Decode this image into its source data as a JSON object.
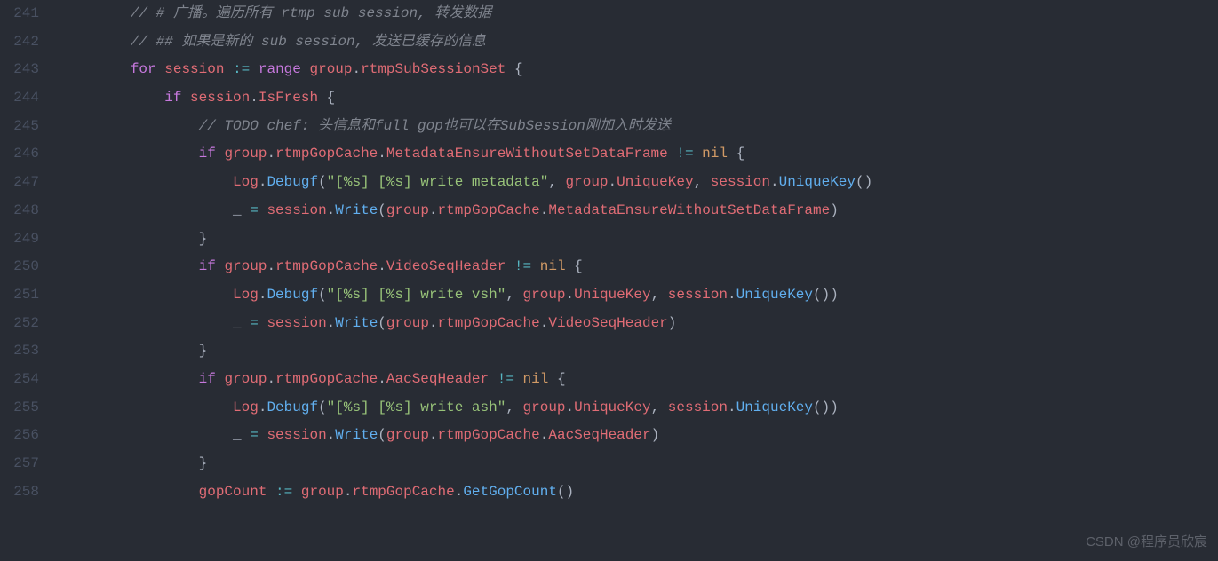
{
  "watermark": "CSDN @程序员欣宸",
  "lines": [
    {
      "n": "241",
      "indent": 2,
      "segs": [
        {
          "c": "cm",
          "t": "// # 广播。遍历所有 rtmp sub session, 转发数据"
        }
      ]
    },
    {
      "n": "242",
      "indent": 2,
      "segs": [
        {
          "c": "cm",
          "t": "// ## 如果是新的 sub session, 发送已缓存的信息"
        }
      ]
    },
    {
      "n": "243",
      "indent": 2,
      "segs": [
        {
          "c": "kw",
          "t": "for"
        },
        {
          "c": "pl",
          "t": " "
        },
        {
          "c": "id",
          "t": "session"
        },
        {
          "c": "pl",
          "t": " "
        },
        {
          "c": "op",
          "t": ":="
        },
        {
          "c": "pl",
          "t": " "
        },
        {
          "c": "kw",
          "t": "range"
        },
        {
          "c": "pl",
          "t": " "
        },
        {
          "c": "id",
          "t": "group"
        },
        {
          "c": "pl",
          "t": "."
        },
        {
          "c": "id",
          "t": "rtmpSubSessionSet"
        },
        {
          "c": "pl",
          "t": " {"
        }
      ]
    },
    {
      "n": "244",
      "indent": 3,
      "segs": [
        {
          "c": "kw",
          "t": "if"
        },
        {
          "c": "pl",
          "t": " "
        },
        {
          "c": "id",
          "t": "session"
        },
        {
          "c": "pl",
          "t": "."
        },
        {
          "c": "id",
          "t": "IsFresh"
        },
        {
          "c": "pl",
          "t": " {"
        }
      ]
    },
    {
      "n": "245",
      "indent": 4,
      "segs": [
        {
          "c": "cm",
          "t": "// TODO chef: 头信息和full gop也可以在SubSession刚加入时发送"
        }
      ]
    },
    {
      "n": "246",
      "indent": 4,
      "segs": [
        {
          "c": "kw",
          "t": "if"
        },
        {
          "c": "pl",
          "t": " "
        },
        {
          "c": "id",
          "t": "group"
        },
        {
          "c": "pl",
          "t": "."
        },
        {
          "c": "id",
          "t": "rtmpGopCache"
        },
        {
          "c": "pl",
          "t": "."
        },
        {
          "c": "id",
          "t": "MetadataEnsureWithoutSetDataFrame"
        },
        {
          "c": "pl",
          "t": " "
        },
        {
          "c": "op",
          "t": "!="
        },
        {
          "c": "pl",
          "t": " "
        },
        {
          "c": "con",
          "t": "nil"
        },
        {
          "c": "pl",
          "t": " {"
        }
      ]
    },
    {
      "n": "247",
      "indent": 5,
      "segs": [
        {
          "c": "id",
          "t": "Log"
        },
        {
          "c": "pl",
          "t": "."
        },
        {
          "c": "fn",
          "t": "Debugf"
        },
        {
          "c": "pl",
          "t": "("
        },
        {
          "c": "str",
          "t": "\"[%s] [%s] write metadata\""
        },
        {
          "c": "pl",
          "t": ", "
        },
        {
          "c": "id",
          "t": "group"
        },
        {
          "c": "pl",
          "t": "."
        },
        {
          "c": "id",
          "t": "UniqueKey"
        },
        {
          "c": "pl",
          "t": ", "
        },
        {
          "c": "id",
          "t": "session"
        },
        {
          "c": "pl",
          "t": "."
        },
        {
          "c": "fn",
          "t": "UniqueKey"
        },
        {
          "c": "pl",
          "t": "()"
        }
      ]
    },
    {
      "n": "248",
      "indent": 5,
      "segs": [
        {
          "c": "pl",
          "t": "_ "
        },
        {
          "c": "op",
          "t": "="
        },
        {
          "c": "pl",
          "t": " "
        },
        {
          "c": "id",
          "t": "session"
        },
        {
          "c": "pl",
          "t": "."
        },
        {
          "c": "fn",
          "t": "Write"
        },
        {
          "c": "pl",
          "t": "("
        },
        {
          "c": "id",
          "t": "group"
        },
        {
          "c": "pl",
          "t": "."
        },
        {
          "c": "id",
          "t": "rtmpGopCache"
        },
        {
          "c": "pl",
          "t": "."
        },
        {
          "c": "id",
          "t": "MetadataEnsureWithoutSetDataFrame"
        },
        {
          "c": "pl",
          "t": ")"
        }
      ]
    },
    {
      "n": "249",
      "indent": 4,
      "segs": [
        {
          "c": "pl",
          "t": "}"
        }
      ]
    },
    {
      "n": "250",
      "indent": 4,
      "segs": [
        {
          "c": "kw",
          "t": "if"
        },
        {
          "c": "pl",
          "t": " "
        },
        {
          "c": "id",
          "t": "group"
        },
        {
          "c": "pl",
          "t": "."
        },
        {
          "c": "id",
          "t": "rtmpGopCache"
        },
        {
          "c": "pl",
          "t": "."
        },
        {
          "c": "id",
          "t": "VideoSeqHeader"
        },
        {
          "c": "pl",
          "t": " "
        },
        {
          "c": "op",
          "t": "!="
        },
        {
          "c": "pl",
          "t": " "
        },
        {
          "c": "con",
          "t": "nil"
        },
        {
          "c": "pl",
          "t": " {"
        }
      ]
    },
    {
      "n": "251",
      "indent": 5,
      "segs": [
        {
          "c": "id",
          "t": "Log"
        },
        {
          "c": "pl",
          "t": "."
        },
        {
          "c": "fn",
          "t": "Debugf"
        },
        {
          "c": "pl",
          "t": "("
        },
        {
          "c": "str",
          "t": "\"[%s] [%s] write vsh\""
        },
        {
          "c": "pl",
          "t": ", "
        },
        {
          "c": "id",
          "t": "group"
        },
        {
          "c": "pl",
          "t": "."
        },
        {
          "c": "id",
          "t": "UniqueKey"
        },
        {
          "c": "pl",
          "t": ", "
        },
        {
          "c": "id",
          "t": "session"
        },
        {
          "c": "pl",
          "t": "."
        },
        {
          "c": "fn",
          "t": "UniqueKey"
        },
        {
          "c": "pl",
          "t": "())"
        }
      ]
    },
    {
      "n": "252",
      "indent": 5,
      "segs": [
        {
          "c": "pl",
          "t": "_ "
        },
        {
          "c": "op",
          "t": "="
        },
        {
          "c": "pl",
          "t": " "
        },
        {
          "c": "id",
          "t": "session"
        },
        {
          "c": "pl",
          "t": "."
        },
        {
          "c": "fn",
          "t": "Write"
        },
        {
          "c": "pl",
          "t": "("
        },
        {
          "c": "id",
          "t": "group"
        },
        {
          "c": "pl",
          "t": "."
        },
        {
          "c": "id",
          "t": "rtmpGopCache"
        },
        {
          "c": "pl",
          "t": "."
        },
        {
          "c": "id",
          "t": "VideoSeqHeader"
        },
        {
          "c": "pl",
          "t": ")"
        }
      ]
    },
    {
      "n": "253",
      "indent": 4,
      "segs": [
        {
          "c": "pl",
          "t": "}"
        }
      ]
    },
    {
      "n": "254",
      "indent": 4,
      "segs": [
        {
          "c": "kw",
          "t": "if"
        },
        {
          "c": "pl",
          "t": " "
        },
        {
          "c": "id",
          "t": "group"
        },
        {
          "c": "pl",
          "t": "."
        },
        {
          "c": "id",
          "t": "rtmpGopCache"
        },
        {
          "c": "pl",
          "t": "."
        },
        {
          "c": "id",
          "t": "AacSeqHeader"
        },
        {
          "c": "pl",
          "t": " "
        },
        {
          "c": "op",
          "t": "!="
        },
        {
          "c": "pl",
          "t": " "
        },
        {
          "c": "con",
          "t": "nil"
        },
        {
          "c": "pl",
          "t": " {"
        }
      ]
    },
    {
      "n": "255",
      "indent": 5,
      "segs": [
        {
          "c": "id",
          "t": "Log"
        },
        {
          "c": "pl",
          "t": "."
        },
        {
          "c": "fn",
          "t": "Debugf"
        },
        {
          "c": "pl",
          "t": "("
        },
        {
          "c": "str",
          "t": "\"[%s] [%s] write ash\""
        },
        {
          "c": "pl",
          "t": ", "
        },
        {
          "c": "id",
          "t": "group"
        },
        {
          "c": "pl",
          "t": "."
        },
        {
          "c": "id",
          "t": "UniqueKey"
        },
        {
          "c": "pl",
          "t": ", "
        },
        {
          "c": "id",
          "t": "session"
        },
        {
          "c": "pl",
          "t": "."
        },
        {
          "c": "fn",
          "t": "UniqueKey"
        },
        {
          "c": "pl",
          "t": "())"
        }
      ]
    },
    {
      "n": "256",
      "indent": 5,
      "segs": [
        {
          "c": "pl",
          "t": "_ "
        },
        {
          "c": "op",
          "t": "="
        },
        {
          "c": "pl",
          "t": " "
        },
        {
          "c": "id",
          "t": "session"
        },
        {
          "c": "pl",
          "t": "."
        },
        {
          "c": "fn",
          "t": "Write"
        },
        {
          "c": "pl",
          "t": "("
        },
        {
          "c": "id",
          "t": "group"
        },
        {
          "c": "pl",
          "t": "."
        },
        {
          "c": "id",
          "t": "rtmpGopCache"
        },
        {
          "c": "pl",
          "t": "."
        },
        {
          "c": "id",
          "t": "AacSeqHeader"
        },
        {
          "c": "pl",
          "t": ")"
        }
      ]
    },
    {
      "n": "257",
      "indent": 4,
      "segs": [
        {
          "c": "pl",
          "t": "}"
        }
      ]
    },
    {
      "n": "258",
      "indent": 4,
      "segs": [
        {
          "c": "id",
          "t": "gopCount"
        },
        {
          "c": "pl",
          "t": " "
        },
        {
          "c": "op",
          "t": ":="
        },
        {
          "c": "pl",
          "t": " "
        },
        {
          "c": "id",
          "t": "group"
        },
        {
          "c": "pl",
          "t": "."
        },
        {
          "c": "id",
          "t": "rtmpGopCache"
        },
        {
          "c": "pl",
          "t": "."
        },
        {
          "c": "fn",
          "t": "GetGopCount"
        },
        {
          "c": "pl",
          "t": "()"
        }
      ]
    }
  ]
}
